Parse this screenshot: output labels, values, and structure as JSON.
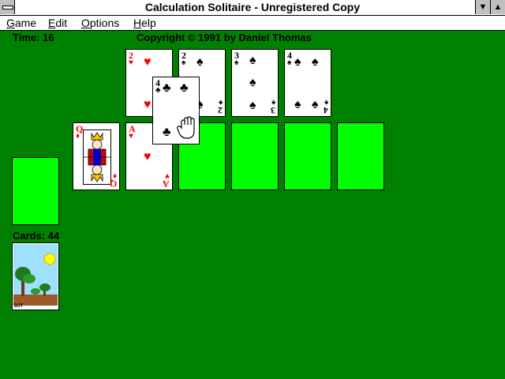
{
  "window": {
    "title": "Calculation Solitaire - Unregistered Copy",
    "min_glyph": "▼",
    "max_glyph": "▲"
  },
  "menu": {
    "items": [
      {
        "label_u": "G",
        "label_rest": "ame"
      },
      {
        "label_u": "E",
        "label_rest": "dit"
      },
      {
        "label_u": "O",
        "label_rest": "ptions"
      },
      {
        "label_u": "H",
        "label_rest": "elp"
      }
    ]
  },
  "status": {
    "time": "Time: 16",
    "copyright": "Copyright © 1991 by Daniel Thomas",
    "cards": "Cards: 44"
  },
  "foundations": [
    {
      "rank": "2",
      "suit": "♥",
      "color": "red"
    },
    {
      "rank": "2",
      "suit": "♠",
      "color": "black"
    },
    {
      "rank": "3",
      "suit": "♠",
      "color": "black"
    },
    {
      "rank": "4",
      "suit": "♠",
      "color": "black"
    }
  ],
  "tableau": [
    {
      "rank": "Q",
      "suit": "♦",
      "color": "red"
    },
    {
      "rank": "A",
      "suit": "♥",
      "color": "red"
    },
    {
      "empty": true
    },
    {
      "empty": true
    },
    {
      "empty": true
    }
  ],
  "dragged_card": {
    "rank": "4",
    "suit": "♣",
    "color": "black"
  },
  "deck_label": "DJT",
  "colors": {
    "felt": "#008000",
    "slot": "#00ff00",
    "red_suit": "#ff0000"
  },
  "icons": {
    "cursor": "hand-grab-icon"
  }
}
